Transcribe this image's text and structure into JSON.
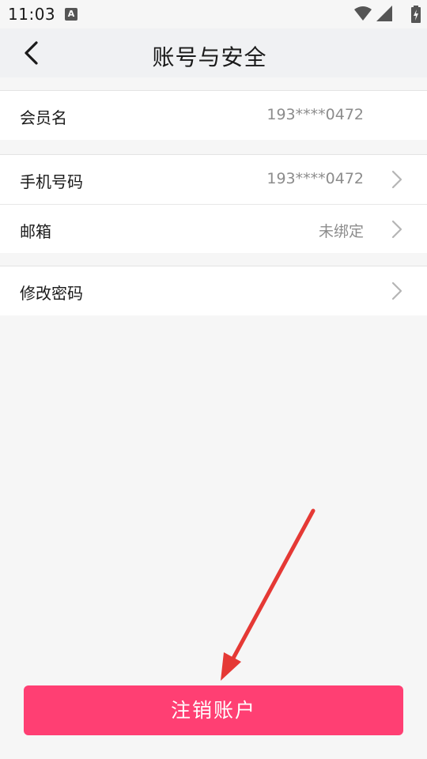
{
  "status_bar": {
    "time": "11:03",
    "notification_icon": "a-icon",
    "icons": [
      "wifi-icon",
      "signal-icon",
      "battery-charging-icon"
    ]
  },
  "header": {
    "title": "账号与安全",
    "back_icon": "back-arrow-icon"
  },
  "groups": [
    {
      "rows": [
        {
          "label": "会员名",
          "value": "193****0472",
          "has_chevron": false
        }
      ]
    },
    {
      "rows": [
        {
          "label": "手机号码",
          "value": "193****0472",
          "has_chevron": true
        },
        {
          "label": "邮箱",
          "value": "未绑定",
          "has_chevron": true
        }
      ]
    },
    {
      "rows": [
        {
          "label": "修改密码",
          "value": "",
          "has_chevron": true
        }
      ]
    }
  ],
  "footer": {
    "cancel_account_label": "注销账户"
  },
  "colors": {
    "accent": "#ff3f73",
    "annotation_arrow": "#e53935",
    "background": "#f6f6f6"
  }
}
